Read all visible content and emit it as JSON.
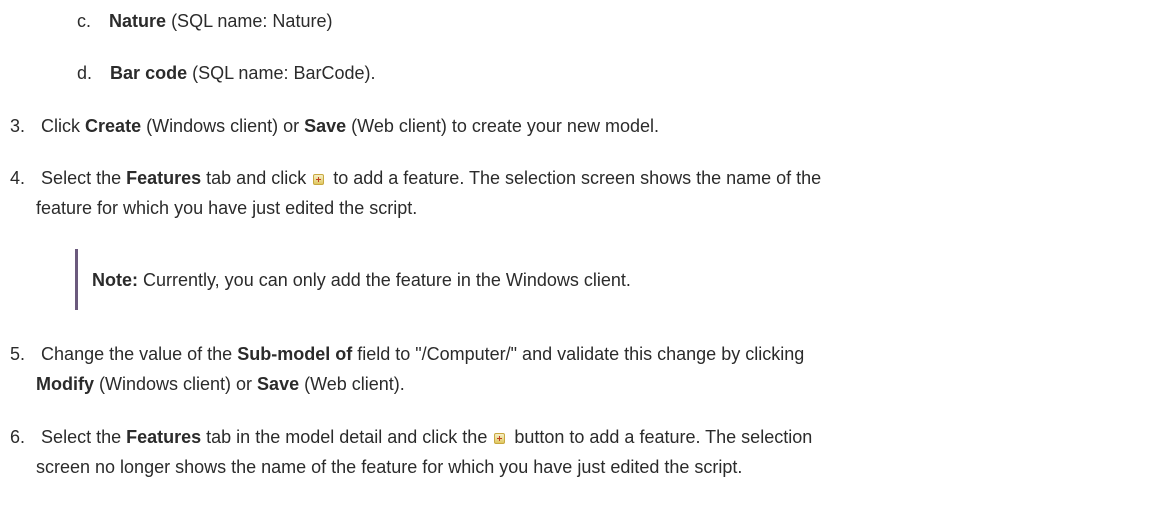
{
  "items": {
    "c": {
      "marker": "c.",
      "bold": "Nature",
      "rest": " (SQL name: Nature)"
    },
    "d": {
      "marker": "d.",
      "bold": "Bar code",
      "rest": " (SQL name: BarCode)."
    },
    "step3": {
      "marker": "3.",
      "pre": "Click ",
      "b1": "Create",
      "mid": " (Windows client) or ",
      "b2": "Save",
      "post": " (Web client) to create your new model."
    },
    "step4": {
      "marker": "4.",
      "pre": "Select the ",
      "b1": "Features",
      "mid": " tab and click ",
      "post": " to add a feature. The selection screen shows the name of the",
      "line2": "feature for which you have just edited the script."
    },
    "note": {
      "label": "Note:",
      "text": "  Currently, you can only add the feature in the Windows client."
    },
    "step5": {
      "marker": "5.",
      "pre": "Change the value of the ",
      "b1": "Sub-model of",
      "post": " field to \"/Computer/\" and validate this change by clicking",
      "l2b1": "Modify",
      "l2mid": " (Windows client) or ",
      "l2b2": "Save",
      "l2post": " (Web client)."
    },
    "step6": {
      "marker": "6.",
      "pre": "Select the ",
      "b1": "Features",
      "mid": " tab in the model detail and click the ",
      "post": " button to add a feature. The selection",
      "line2": "screen no longer shows the name of the feature for which you have just edited the script."
    }
  },
  "icons": {
    "add": "add-feature-icon"
  },
  "colors": {
    "text": "#2b2b2b",
    "note_bar": "#6b5a7d"
  }
}
